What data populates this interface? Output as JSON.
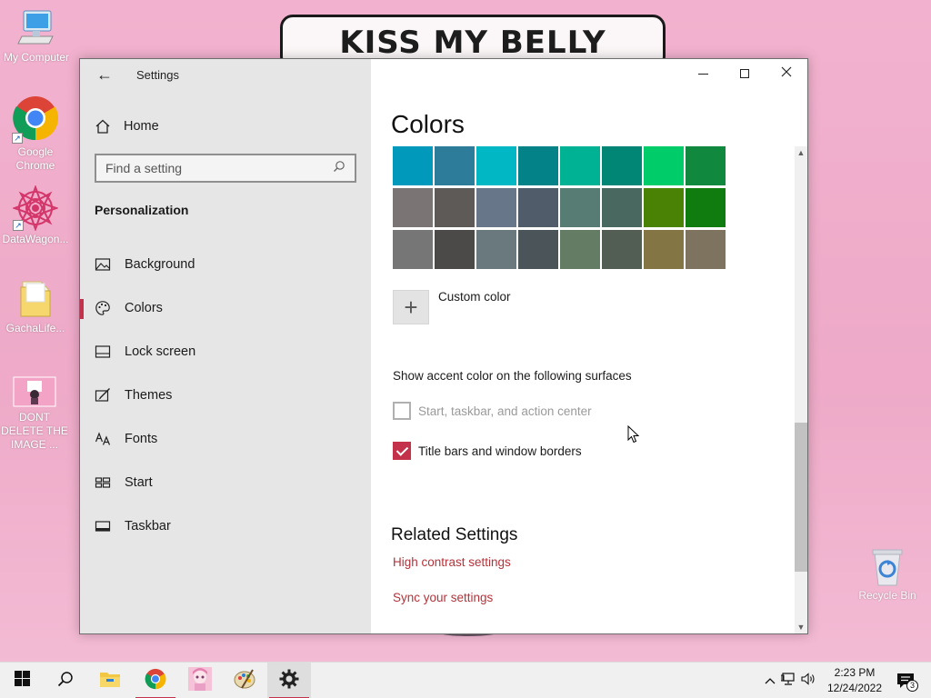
{
  "wallpaper": {
    "banner_text": "KISS MY BELLY"
  },
  "desktop_icons": [
    {
      "label": "My Computer",
      "icon": "computer-icon"
    },
    {
      "label": "Google Chrome",
      "icon": "chrome-icon"
    },
    {
      "label": "DataWagon...",
      "icon": "datawagon-icon"
    },
    {
      "label": "GachaLife...",
      "icon": "folder-icon"
    },
    {
      "label": "DONT DELETE THE IMAGE ...",
      "icon": "image-thumbnail-icon"
    },
    {
      "label": "Recycle Bin",
      "icon": "recycle-bin-icon"
    }
  ],
  "window": {
    "title": "Settings",
    "controls": {
      "minimize": "—",
      "maximize": "☐",
      "close": "✕"
    }
  },
  "nav": {
    "home_label": "Home",
    "search_placeholder": "Find a setting",
    "section_title": "Personalization",
    "items": [
      {
        "label": "Background",
        "icon": "picture-icon",
        "active": false
      },
      {
        "label": "Colors",
        "icon": "palette-icon",
        "active": true
      },
      {
        "label": "Lock screen",
        "icon": "lock-screen-icon",
        "active": false
      },
      {
        "label": "Themes",
        "icon": "themes-icon",
        "active": false
      },
      {
        "label": "Fonts",
        "icon": "fonts-icon",
        "active": false
      },
      {
        "label": "Start",
        "icon": "start-icon",
        "active": false
      },
      {
        "label": "Taskbar",
        "icon": "taskbar-icon",
        "active": false
      }
    ]
  },
  "content": {
    "title": "Colors",
    "swatches": [
      "#0099bc",
      "#2d7d9a",
      "#00b7c3",
      "#038387",
      "#00b294",
      "#018574",
      "#00cc6a",
      "#10893e",
      "#7a7574",
      "#5d5a58",
      "#68768a",
      "#515c6b",
      "#567c73",
      "#486860",
      "#498205",
      "#107c10",
      "#767676",
      "#4c4a48",
      "#69797e",
      "#4a5459",
      "#647c64",
      "#525e54",
      "#847545",
      "#7e735f"
    ],
    "custom_color_label": "Custom color",
    "surfaces_heading": "Show accent color on the following surfaces",
    "checkboxes": [
      {
        "label": "Start, taskbar, and action center",
        "checked": false,
        "disabled": true
      },
      {
        "label": "Title bars and window borders",
        "checked": true,
        "disabled": false
      }
    ],
    "related_title": "Related Settings",
    "links": [
      "High contrast settings",
      "Sync your settings"
    ]
  },
  "taskbar": {
    "apps": [
      {
        "name": "start-button",
        "icon": "windows-logo-icon"
      },
      {
        "name": "search-button",
        "icon": "search-icon"
      },
      {
        "name": "file-explorer",
        "icon": "folder-icon"
      },
      {
        "name": "chrome",
        "icon": "chrome-icon",
        "running": true
      },
      {
        "name": "gacha-app",
        "icon": "anime-app-icon"
      },
      {
        "name": "paint-app",
        "icon": "paint-palette-icon"
      },
      {
        "name": "settings-app",
        "icon": "gear-icon",
        "running": true,
        "active": true
      }
    ],
    "clock": {
      "time": "2:23 PM",
      "date": "12/24/2022"
    },
    "notification_count": "3"
  },
  "colors": {
    "accent": "#c4314b",
    "link": "#b3333b"
  }
}
